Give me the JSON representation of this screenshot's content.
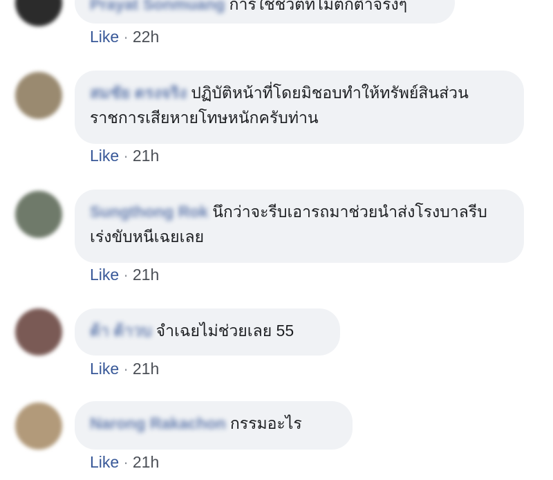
{
  "comments": [
    {
      "author": "Prayat Sonmuang",
      "text": "การใช้ชีวิตที่ไม่ตกต่ำจริงๆ",
      "like_label": "Like",
      "time": "22h",
      "avatar_color": "#2b2b2b"
    },
    {
      "author": "สมชัย ตรงจริง",
      "text": "ปฏิบัติหน้าที่โดยมิชอบทำให้ทรัพย์สินส่วนราชการเสียหายโทษหนักครับท่าน",
      "like_label": "Like",
      "time": "21h",
      "avatar_color": "#9a8a70"
    },
    {
      "author": "Sungthong Rok",
      "text": "นึกว่าจะรีบเอารถมาช่วยนำส่งโรงบาลรีบเร่งขับหนีเฉยเลย",
      "like_label": "Like",
      "time": "21h",
      "avatar_color": "#6f7a6a"
    },
    {
      "author": "ต้า ต้าวบ",
      "text": "จำเฉยไม่ช่วยเลย 55",
      "like_label": "Like",
      "time": "21h",
      "avatar_color": "#7a5a55"
    },
    {
      "author": "Narong Rakachon",
      "text": "กรรมอะไร",
      "like_label": "Like",
      "time": "21h",
      "avatar_color": "#b29a7a"
    }
  ],
  "dot": "·"
}
